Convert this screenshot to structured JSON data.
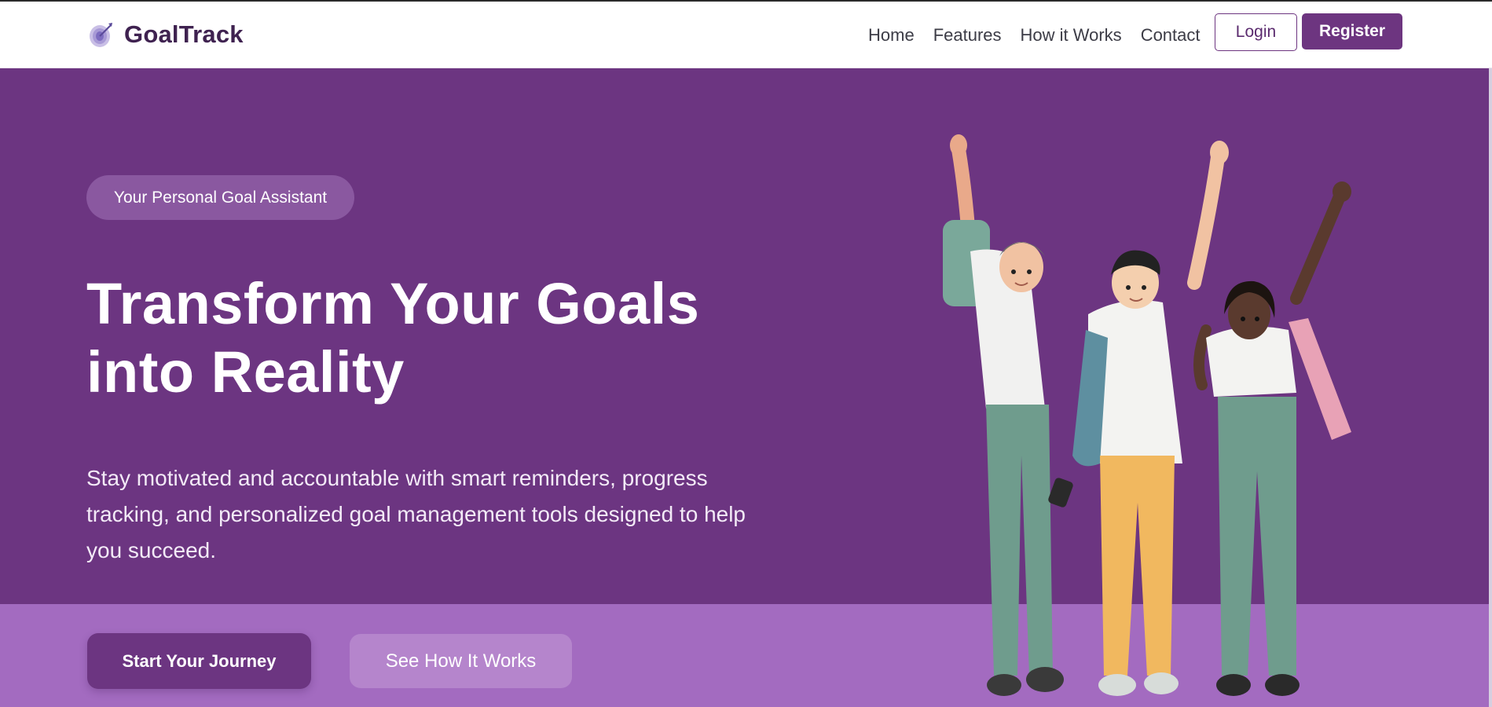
{
  "brand": {
    "name": "GoalTrack",
    "icon": "target-icon"
  },
  "nav": {
    "links": [
      "Home",
      "Features",
      "How it Works",
      "Contact"
    ],
    "login_label": "Login",
    "register_label": "Register"
  },
  "hero": {
    "badge": "Your Personal Goal Assistant",
    "headline_line1": "Transform Your Goals",
    "headline_line2": "into Reality",
    "subtext": "Stay motivated and accountable with smart reminders, progress tracking, and personalized goal management tools designed to help you succeed.",
    "primary_cta": "Start Your Journey",
    "secondary_cta": "See How It Works",
    "illustration": "three-cheering-people-illustration"
  },
  "colors": {
    "brand_purple": "#6c3581",
    "hero_lower": "#a36bc0",
    "badge": "#8a58a0",
    "secondary_button": "#b585cc",
    "brand_text": "#3f2250"
  }
}
